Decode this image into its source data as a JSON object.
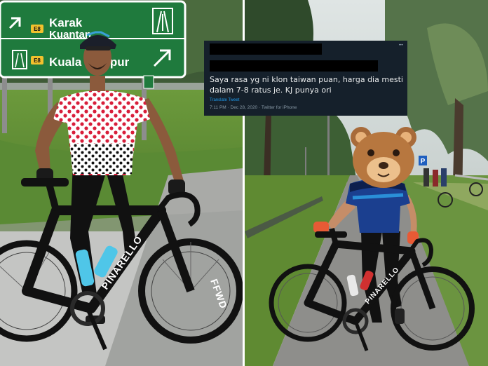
{
  "left_photo": {
    "sign": {
      "line1": "Karak",
      "line1_route": "E8",
      "line2": "Kuantan",
      "line3": "Kuala Lumpur",
      "line3_route": "E8",
      "sign_color": "#1f7a3d"
    },
    "bike_brand": "PINARELLO",
    "wheel_brand": "FFWD",
    "jersey_pattern": "white-with-red-dots"
  },
  "right_photo": {
    "bike_brand": "PINARELLO",
    "face_cover_emoji": "bear-face",
    "parking_sign": "P"
  },
  "tweet": {
    "text": "Saya rasa yg ni klon taiwan puan, harga dia mesti dalam 7-8 ratus je. KJ punya ori",
    "translate_label": "Translate Tweet",
    "timestamp": "7:11 PM · Dec 28, 2020 · Twitter for iPhone",
    "background": "#15202b"
  }
}
